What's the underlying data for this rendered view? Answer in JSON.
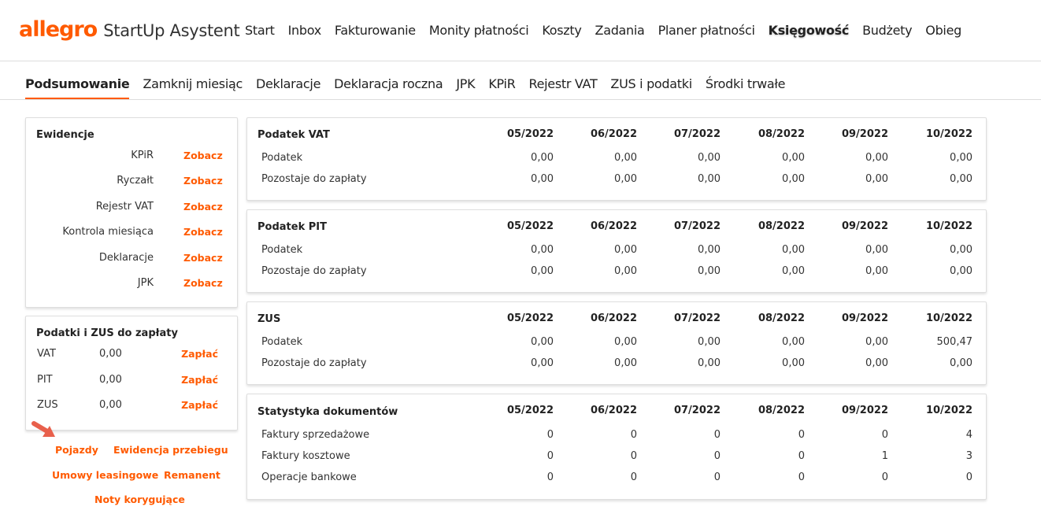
{
  "header": {
    "logo_brand": "allegro",
    "logo_product": "StartUp Asystent",
    "nav": [
      "Start",
      "Inbox",
      "Fakturowanie",
      "Monity płatności",
      "Koszty",
      "Zadania",
      "Planer płatności",
      "Księgowość",
      "Budżety",
      "Obieg"
    ],
    "active_nav": "Księgowość"
  },
  "subnav": {
    "items": [
      "Podsumowanie",
      "Zamknij miesiąc",
      "Deklaracje",
      "Deklaracja roczna",
      "JPK",
      "KPiR",
      "Rejestr VAT",
      "ZUS i podatki",
      "Środki trwałe"
    ],
    "active": "Podsumowanie"
  },
  "ewidencje": {
    "title": "Ewidencje",
    "items": [
      {
        "label": "KPiR",
        "link": "Zobacz"
      },
      {
        "label": "Ryczałt",
        "link": "Zobacz"
      },
      {
        "label": "Rejestr VAT",
        "link": "Zobacz"
      },
      {
        "label": "Kontrola miesiąca",
        "link": "Zobacz"
      },
      {
        "label": "Deklaracje",
        "link": "Zobacz"
      },
      {
        "label": "JPK",
        "link": "Zobacz"
      }
    ]
  },
  "podatki": {
    "title": "Podatki i ZUS do zapłaty",
    "items": [
      {
        "name": "VAT",
        "value": "0,00",
        "link": "Zapłać"
      },
      {
        "name": "PIT",
        "value": "0,00",
        "link": "Zapłać"
      },
      {
        "name": "ZUS",
        "value": "0,00",
        "link": "Zapłać"
      }
    ]
  },
  "bottom_links": {
    "pojazdy": "Pojazdy",
    "ewidencja_przebiegu": "Ewidencja przebiegu",
    "umowy_leasingowe": "Umowy leasingowe",
    "remanent": "Remanent",
    "noty_korygujace": "Noty korygujące"
  },
  "months": [
    "05/2022",
    "06/2022",
    "07/2022",
    "08/2022",
    "09/2022",
    "10/2022"
  ],
  "tables": [
    {
      "title": "Podatek VAT",
      "rows": [
        {
          "label": "Podatek",
          "values": [
            "0,00",
            "0,00",
            "0,00",
            "0,00",
            "0,00",
            "0,00"
          ]
        },
        {
          "label": "Pozostaje do zapłaty",
          "values": [
            "0,00",
            "0,00",
            "0,00",
            "0,00",
            "0,00",
            "0,00"
          ]
        }
      ]
    },
    {
      "title": "Podatek PIT",
      "rows": [
        {
          "label": "Podatek",
          "values": [
            "0,00",
            "0,00",
            "0,00",
            "0,00",
            "0,00",
            "0,00"
          ]
        },
        {
          "label": "Pozostaje do zapłaty",
          "values": [
            "0,00",
            "0,00",
            "0,00",
            "0,00",
            "0,00",
            "0,00"
          ]
        }
      ]
    },
    {
      "title": "ZUS",
      "rows": [
        {
          "label": "Podatek",
          "values": [
            "0,00",
            "0,00",
            "0,00",
            "0,00",
            "0,00",
            "500,47"
          ]
        },
        {
          "label": "Pozostaje do zapłaty",
          "values": [
            "0,00",
            "0,00",
            "0,00",
            "0,00",
            "0,00",
            "0,00"
          ]
        }
      ]
    },
    {
      "title": "Statystyka dokumentów",
      "rows": [
        {
          "label": "Faktury sprzedażowe",
          "values": [
            "0",
            "0",
            "0",
            "0",
            "0",
            "4"
          ]
        },
        {
          "label": "Faktury kosztowe",
          "values": [
            "0",
            "0",
            "0",
            "0",
            "1",
            "3"
          ]
        },
        {
          "label": "Operacje bankowe",
          "values": [
            "0",
            "0",
            "0",
            "0",
            "0",
            "0"
          ]
        }
      ]
    }
  ],
  "colors": {
    "accent": "#ff5a00"
  }
}
